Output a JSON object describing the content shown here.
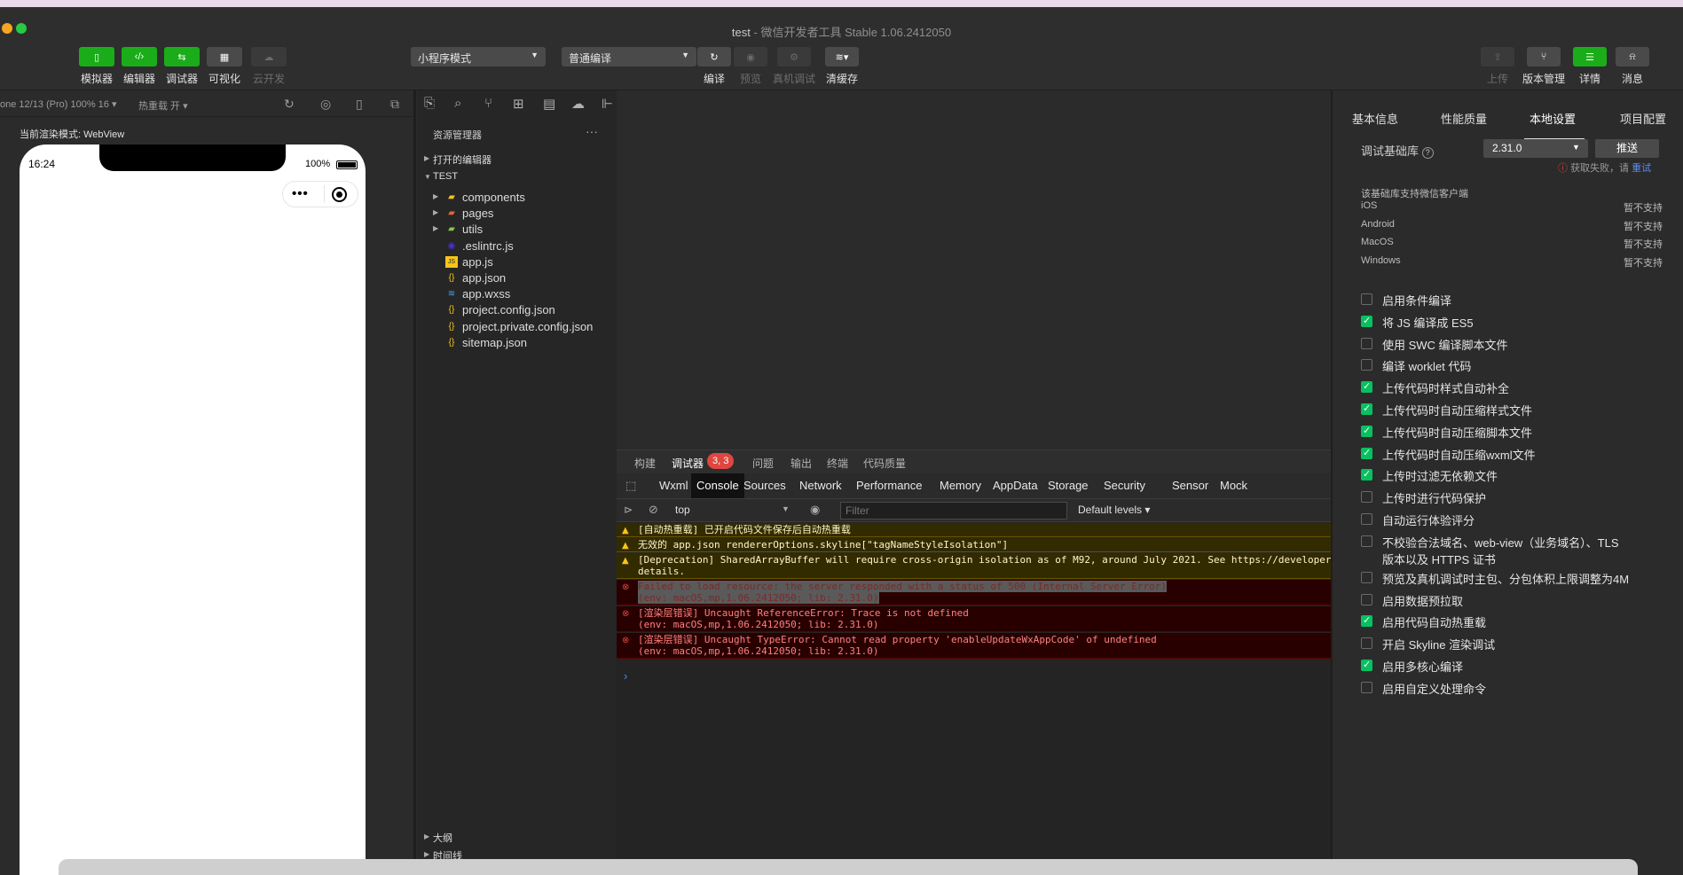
{
  "window": {
    "title": "test",
    "subtitle": "微信开发者工具 Stable 1.06.2412050"
  },
  "toolbar": {
    "left": [
      {
        "label": "模拟器",
        "icon": "phone-icon"
      },
      {
        "label": "编辑器",
        "icon": "code-icon"
      },
      {
        "label": "调试器",
        "icon": "debug-icon"
      },
      {
        "label": "可视化",
        "icon": "layout-icon"
      },
      {
        "label": "云开发",
        "icon": "cloud-icon"
      }
    ],
    "mode_select": "小程序模式",
    "compile_select": "普通编译",
    "center": [
      {
        "label": "编译",
        "icon": "refresh-icon"
      },
      {
        "label": "预览",
        "icon": "eye-icon"
      },
      {
        "label": "真机调试",
        "icon": "bug-icon"
      },
      {
        "label": "清缓存",
        "icon": "layers-icon"
      }
    ],
    "right": [
      {
        "label": "上传",
        "icon": "upload-icon"
      },
      {
        "label": "版本管理",
        "icon": "branch-icon"
      },
      {
        "label": "详情",
        "icon": "menu-icon"
      },
      {
        "label": "消息",
        "icon": "bell-icon"
      }
    ]
  },
  "simulator": {
    "device": "one 12/13 (Pro) 100% 16 ▾",
    "hot_reload": "热重载 开 ▾",
    "render_mode": "当前渲染模式: WebView",
    "time": "16:24",
    "battery": "100%"
  },
  "explorer": {
    "title": "资源管理器",
    "open_editors": "打开的编辑器",
    "project": "TEST",
    "files": [
      {
        "name": "components",
        "type": "folder",
        "color": "#f5c518"
      },
      {
        "name": "pages",
        "type": "folder",
        "color": "#e8613c"
      },
      {
        "name": "utils",
        "type": "folder",
        "color": "#8bc34a"
      },
      {
        "name": ".eslintrc.js",
        "type": "eslint",
        "color": "#4b32c3"
      },
      {
        "name": "app.js",
        "type": "js",
        "color": "#f5c518"
      },
      {
        "name": "app.json",
        "type": "json",
        "color": "#f5c518"
      },
      {
        "name": "app.wxss",
        "type": "css",
        "color": "#42a5f5"
      },
      {
        "name": "project.config.json",
        "type": "json",
        "color": "#f5c518"
      },
      {
        "name": "project.private.config.json",
        "type": "json",
        "color": "#f5c518"
      },
      {
        "name": "sitemap.json",
        "type": "json",
        "color": "#f5c518"
      }
    ],
    "outline": "大纲",
    "timeline": "时间线"
  },
  "devtools": {
    "top_tabs": [
      "构建",
      "调试器",
      "问题",
      "输出",
      "终端",
      "代码质量"
    ],
    "badge": "3, 3",
    "panels": [
      "Wxml",
      "Console",
      "Sources",
      "Network",
      "Performance",
      "Memory",
      "AppData",
      "Storage",
      "Security",
      "Sensor",
      "Mock"
    ],
    "context": "top",
    "filter_placeholder": "Filter",
    "levels": "Default levels ▾",
    "logs": [
      {
        "level": "warn",
        "text": "[自动热重载] 已开启代码文件保存后自动热重载"
      },
      {
        "level": "warn",
        "text": "无效的 app.json rendererOptions.skyline[\"tagNameStyleIsolation\"]"
      },
      {
        "level": "warn",
        "text": "[Deprecation] SharedArrayBuffer will require cross-origin isolation as of M92, around July 2021. See https://developer\ndetails."
      },
      {
        "level": "err",
        "text": "Failed to load resource: the server responded with a status of 500 (Internal Server Error)\n(env: macOS,mp,1.06.2412050; lib: 2.31.0)"
      },
      {
        "level": "err",
        "text": "[渲染层错误] Uncaught ReferenceError: Trace is not defined\n(env: macOS,mp,1.06.2412050; lib: 2.31.0)"
      },
      {
        "level": "err",
        "text": "[渲染层错误] Uncaught TypeError: Cannot read property 'enableUpdateWxAppCode' of undefined\n(env: macOS,mp,1.06.2412050; lib: 2.31.0)"
      }
    ],
    "prompt": "›"
  },
  "details": {
    "tabs": [
      "基本信息",
      "性能质量",
      "本地设置",
      "项目配置"
    ],
    "lib_label": "调试基础库",
    "lib_version": "2.31.0",
    "push": "推送",
    "fetch_failed": "获取失败，请",
    "retry": "重试",
    "support_title": "该基础库支持微信客户端",
    "platforms": [
      {
        "name": "iOS",
        "value": "暂不支持"
      },
      {
        "name": "Android",
        "value": "暂不支持"
      },
      {
        "name": "MacOS",
        "value": "暂不支持"
      },
      {
        "name": "Windows",
        "value": "暂不支持"
      }
    ],
    "options": [
      {
        "label": "启用条件编译",
        "checked": false
      },
      {
        "label": "将 JS 编译成 ES5",
        "checked": true
      },
      {
        "label": "使用 SWC 编译脚本文件",
        "checked": false
      },
      {
        "label": "编译 worklet 代码",
        "checked": false
      },
      {
        "label": "上传代码时样式自动补全",
        "checked": true
      },
      {
        "label": "上传代码时自动压缩样式文件",
        "checked": true
      },
      {
        "label": "上传代码时自动压缩脚本文件",
        "checked": true
      },
      {
        "label": "上传代码时自动压缩wxml文件",
        "checked": true
      },
      {
        "label": "上传时过滤无依赖文件",
        "checked": true
      },
      {
        "label": "上传时进行代码保护",
        "checked": false
      },
      {
        "label": "自动运行体验评分",
        "checked": false
      },
      {
        "label": "不校验合法域名、web-view（业务域名）、TLS\n版本以及 HTTPS 证书",
        "checked": false
      },
      {
        "label": "预览及真机调试时主包、分包体积上限调整为4M",
        "checked": false
      },
      {
        "label": "启用数据预拉取",
        "checked": false
      },
      {
        "label": "启用代码自动热重载",
        "checked": true
      },
      {
        "label": "开启 Skyline 渲染调试",
        "checked": false
      },
      {
        "label": "启用多核心编译",
        "checked": true
      },
      {
        "label": "启用自定义处理命令",
        "checked": false
      }
    ]
  }
}
